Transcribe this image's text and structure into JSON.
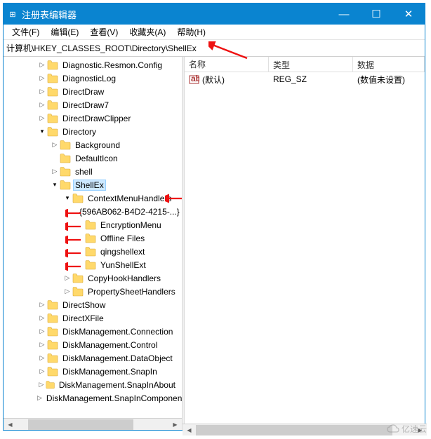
{
  "window": {
    "title": "注册表编辑器",
    "icon": "⊞"
  },
  "titlebar_buttons": {
    "min": "—",
    "max": "☐",
    "close": "✕"
  },
  "menus": [
    "文件(F)",
    "编辑(E)",
    "查看(V)",
    "收藏夹(A)",
    "帮助(H)"
  ],
  "address": "计算机\\HKEY_CLASSES_ROOT\\Directory\\ShellEx",
  "list": {
    "cols": [
      "名称",
      "类型",
      "数据"
    ],
    "rows": [
      {
        "icon": "ab",
        "name": "(默认)",
        "type": "REG_SZ",
        "data": "(数值未设置)"
      }
    ]
  },
  "tree": [
    {
      "d": 2,
      "c": "r",
      "t": "Diagnostic.Resmon.Config"
    },
    {
      "d": 2,
      "c": "r",
      "t": "DiagnosticLog"
    },
    {
      "d": 2,
      "c": "r",
      "t": "DirectDraw"
    },
    {
      "d": 2,
      "c": "r",
      "t": "DirectDraw7"
    },
    {
      "d": 2,
      "c": "r",
      "t": "DirectDrawClipper"
    },
    {
      "d": 2,
      "c": "d",
      "t": "Directory"
    },
    {
      "d": 3,
      "c": "r",
      "t": "Background"
    },
    {
      "d": 3,
      "c": " ",
      "t": "DefaultIcon"
    },
    {
      "d": 3,
      "c": "r",
      "t": "shell"
    },
    {
      "d": 3,
      "c": "d",
      "t": "ShellEx",
      "sel": true
    },
    {
      "d": 4,
      "c": "d",
      "t": "ContextMenuHandlers",
      "arrow": "side"
    },
    {
      "d": 5,
      "c": " ",
      "t": "{596AB062-B4D2-4215-...}",
      "arrow": "left"
    },
    {
      "d": 5,
      "c": " ",
      "t": "EncryptionMenu",
      "arrow": "left"
    },
    {
      "d": 5,
      "c": " ",
      "t": "Offline Files",
      "arrow": "left"
    },
    {
      "d": 5,
      "c": " ",
      "t": "qingshellext",
      "arrow": "left"
    },
    {
      "d": 5,
      "c": " ",
      "t": "YunShellExt",
      "arrow": "left"
    },
    {
      "d": 4,
      "c": "r",
      "t": "CopyHookHandlers"
    },
    {
      "d": 4,
      "c": "r",
      "t": "PropertySheetHandlers"
    },
    {
      "d": 2,
      "c": "r",
      "t": "DirectShow"
    },
    {
      "d": 2,
      "c": "r",
      "t": "DirectXFile"
    },
    {
      "d": 2,
      "c": "r",
      "t": "DiskManagement.Connection"
    },
    {
      "d": 2,
      "c": "r",
      "t": "DiskManagement.Control"
    },
    {
      "d": 2,
      "c": "r",
      "t": "DiskManagement.DataObject"
    },
    {
      "d": 2,
      "c": "r",
      "t": "DiskManagement.SnapIn"
    },
    {
      "d": 2,
      "c": "r",
      "t": "DiskManagement.SnapInAbout"
    },
    {
      "d": 2,
      "c": "r",
      "t": "DiskManagement.SnapInComponent"
    }
  ],
  "watermark": "亿速云"
}
